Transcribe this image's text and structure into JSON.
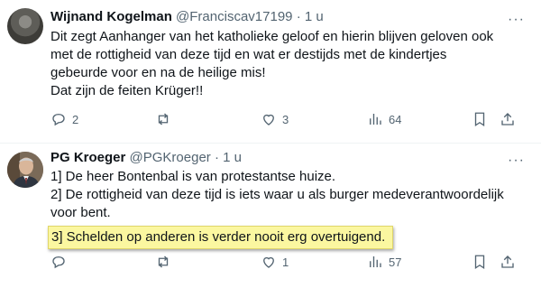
{
  "tweets": [
    {
      "name": "Wijnand Kogelman",
      "handle": "@Franciscav17199",
      "separator": "·",
      "time": "1 u",
      "more": "···",
      "lines": [
        "Dit zegt Aanhanger van het katholieke geloof en hierin blijven geloven ook",
        "met de rottigheid van deze tijd en wat er destijds met de kindertjes",
        "gebeurde voor en na de heilige mis!",
        "Dat zijn de feiten Krüger!!"
      ],
      "replies": "2",
      "reposts": "",
      "likes": "3",
      "views": "64"
    },
    {
      "name": "PG Kroeger",
      "handle": "@PGKroeger",
      "separator": "·",
      "time": "1 u",
      "more": "···",
      "lines": [
        "1] De heer Bontenbal is van protestantse huize.",
        "2] De rottigheid van deze tijd is iets waar u als burger medeverantwoordelijk",
        "voor bent."
      ],
      "highlight": "3] Schelden op anderen is verder nooit erg overtuigend.",
      "highlight_color": "#fbf7a0",
      "replies": "",
      "reposts": "",
      "likes": "1",
      "views": "57"
    }
  ],
  "colors": {
    "text": "#0f1419",
    "muted": "#536471",
    "divider": "#eff3f4"
  },
  "icons": [
    "reply-icon",
    "repost-icon",
    "like-icon",
    "views-icon",
    "bookmark-icon",
    "share-icon",
    "more-icon"
  ]
}
